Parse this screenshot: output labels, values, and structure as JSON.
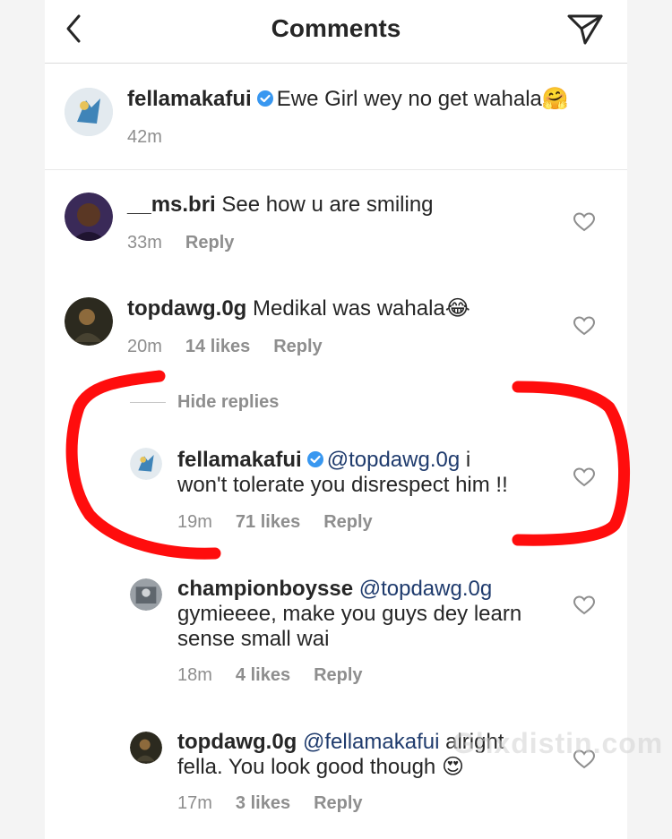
{
  "header": {
    "title": "Comments",
    "back_icon": "chevron-left-icon",
    "send_icon": "paper-plane-icon"
  },
  "caption": {
    "username": "fellamakafui",
    "text": "Ewe Girl wey no get wahala",
    "emoji": "🤗",
    "time": "42m"
  },
  "comments": [
    {
      "username": "__ms.bri",
      "text": "See how u are smiling",
      "time": "33m",
      "reply": "Reply"
    },
    {
      "username": "topdawg.0g",
      "text": "Medikal was wahala",
      "emoji": "😂",
      "time": "20m",
      "likes": "14 likes",
      "reply": "Reply"
    }
  ],
  "hide_replies": "Hide replies",
  "replies": [
    {
      "username": "fellamakafui",
      "mention": "@topdawg.0g",
      "text_line1": "i",
      "text_line2": "won't tolerate you disrespect him !!",
      "time": "19m",
      "likes": "71 likes",
      "reply": "Reply"
    },
    {
      "username": "championboysse",
      "mention": "@topdawg.0g",
      "text_line1": "gymieeee, make you guys dey learn",
      "text_line2": "sense small wai",
      "time": "18m",
      "likes": "4 likes",
      "reply": "Reply"
    },
    {
      "username": "topdawg.0g",
      "mention": "@fellamakafui",
      "text_line1": "alright",
      "text_line2": "fella. You look good though",
      "emoji": "😍",
      "time": "17m",
      "likes": "3 likes",
      "reply": "Reply"
    }
  ],
  "watermark": "Ghxdistin.com",
  "colors": {
    "marker": "#ff0d0d",
    "verified": "#3897f0",
    "muted": "#8e8e8e"
  }
}
